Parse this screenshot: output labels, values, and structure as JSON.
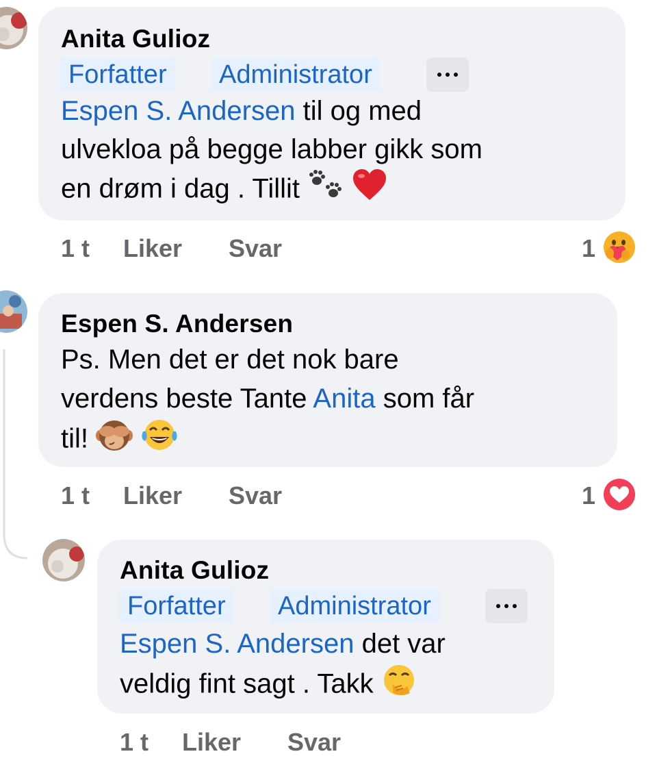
{
  "comments": [
    {
      "author": "Anita Gulioz",
      "badges": [
        "Forfatter",
        "Administrator"
      ],
      "mention": "Espen S. Andersen",
      "line1_rest": " til og med",
      "line2": "ulvekloa på begge labber gikk som",
      "line3": "en drøm i dag . Tillit",
      "emojis": [
        "paw-prints-icon",
        "red-heart-icon"
      ],
      "time": "1 t",
      "like_label": "Liker",
      "reply_label": "Svar",
      "reaction_count": "1",
      "reaction_icon": "care-reaction-icon"
    },
    {
      "author": "Espen S. Andersen",
      "line1": "Ps. Men det er det nok bare",
      "line2_pre": "verdens beste Tante ",
      "mention": "Anita",
      "line2_post": " som får",
      "line3": "til!",
      "emojis": [
        "see-no-evil-monkey-icon",
        "tears-of-joy-icon"
      ],
      "time": "1 t",
      "like_label": "Liker",
      "reply_label": "Svar",
      "reaction_count": "1",
      "reaction_icon": "love-reaction-icon"
    },
    {
      "author": "Anita Gulioz",
      "badges": [
        "Forfatter",
        "Administrator"
      ],
      "mention": "Espen S. Andersen",
      "line1_rest": " det var",
      "line2": "veldig fint sagt . Takk",
      "emojis": [
        "hand-over-mouth-icon"
      ],
      "time": "1 t",
      "like_label": "Liker",
      "reply_label": "Svar"
    }
  ],
  "colors": {
    "bubble": "#f0f2f5",
    "mention": "#1b65c7",
    "meta": "#65676b",
    "badge_bg": "#e7f0fd",
    "love": "#f33e58"
  }
}
